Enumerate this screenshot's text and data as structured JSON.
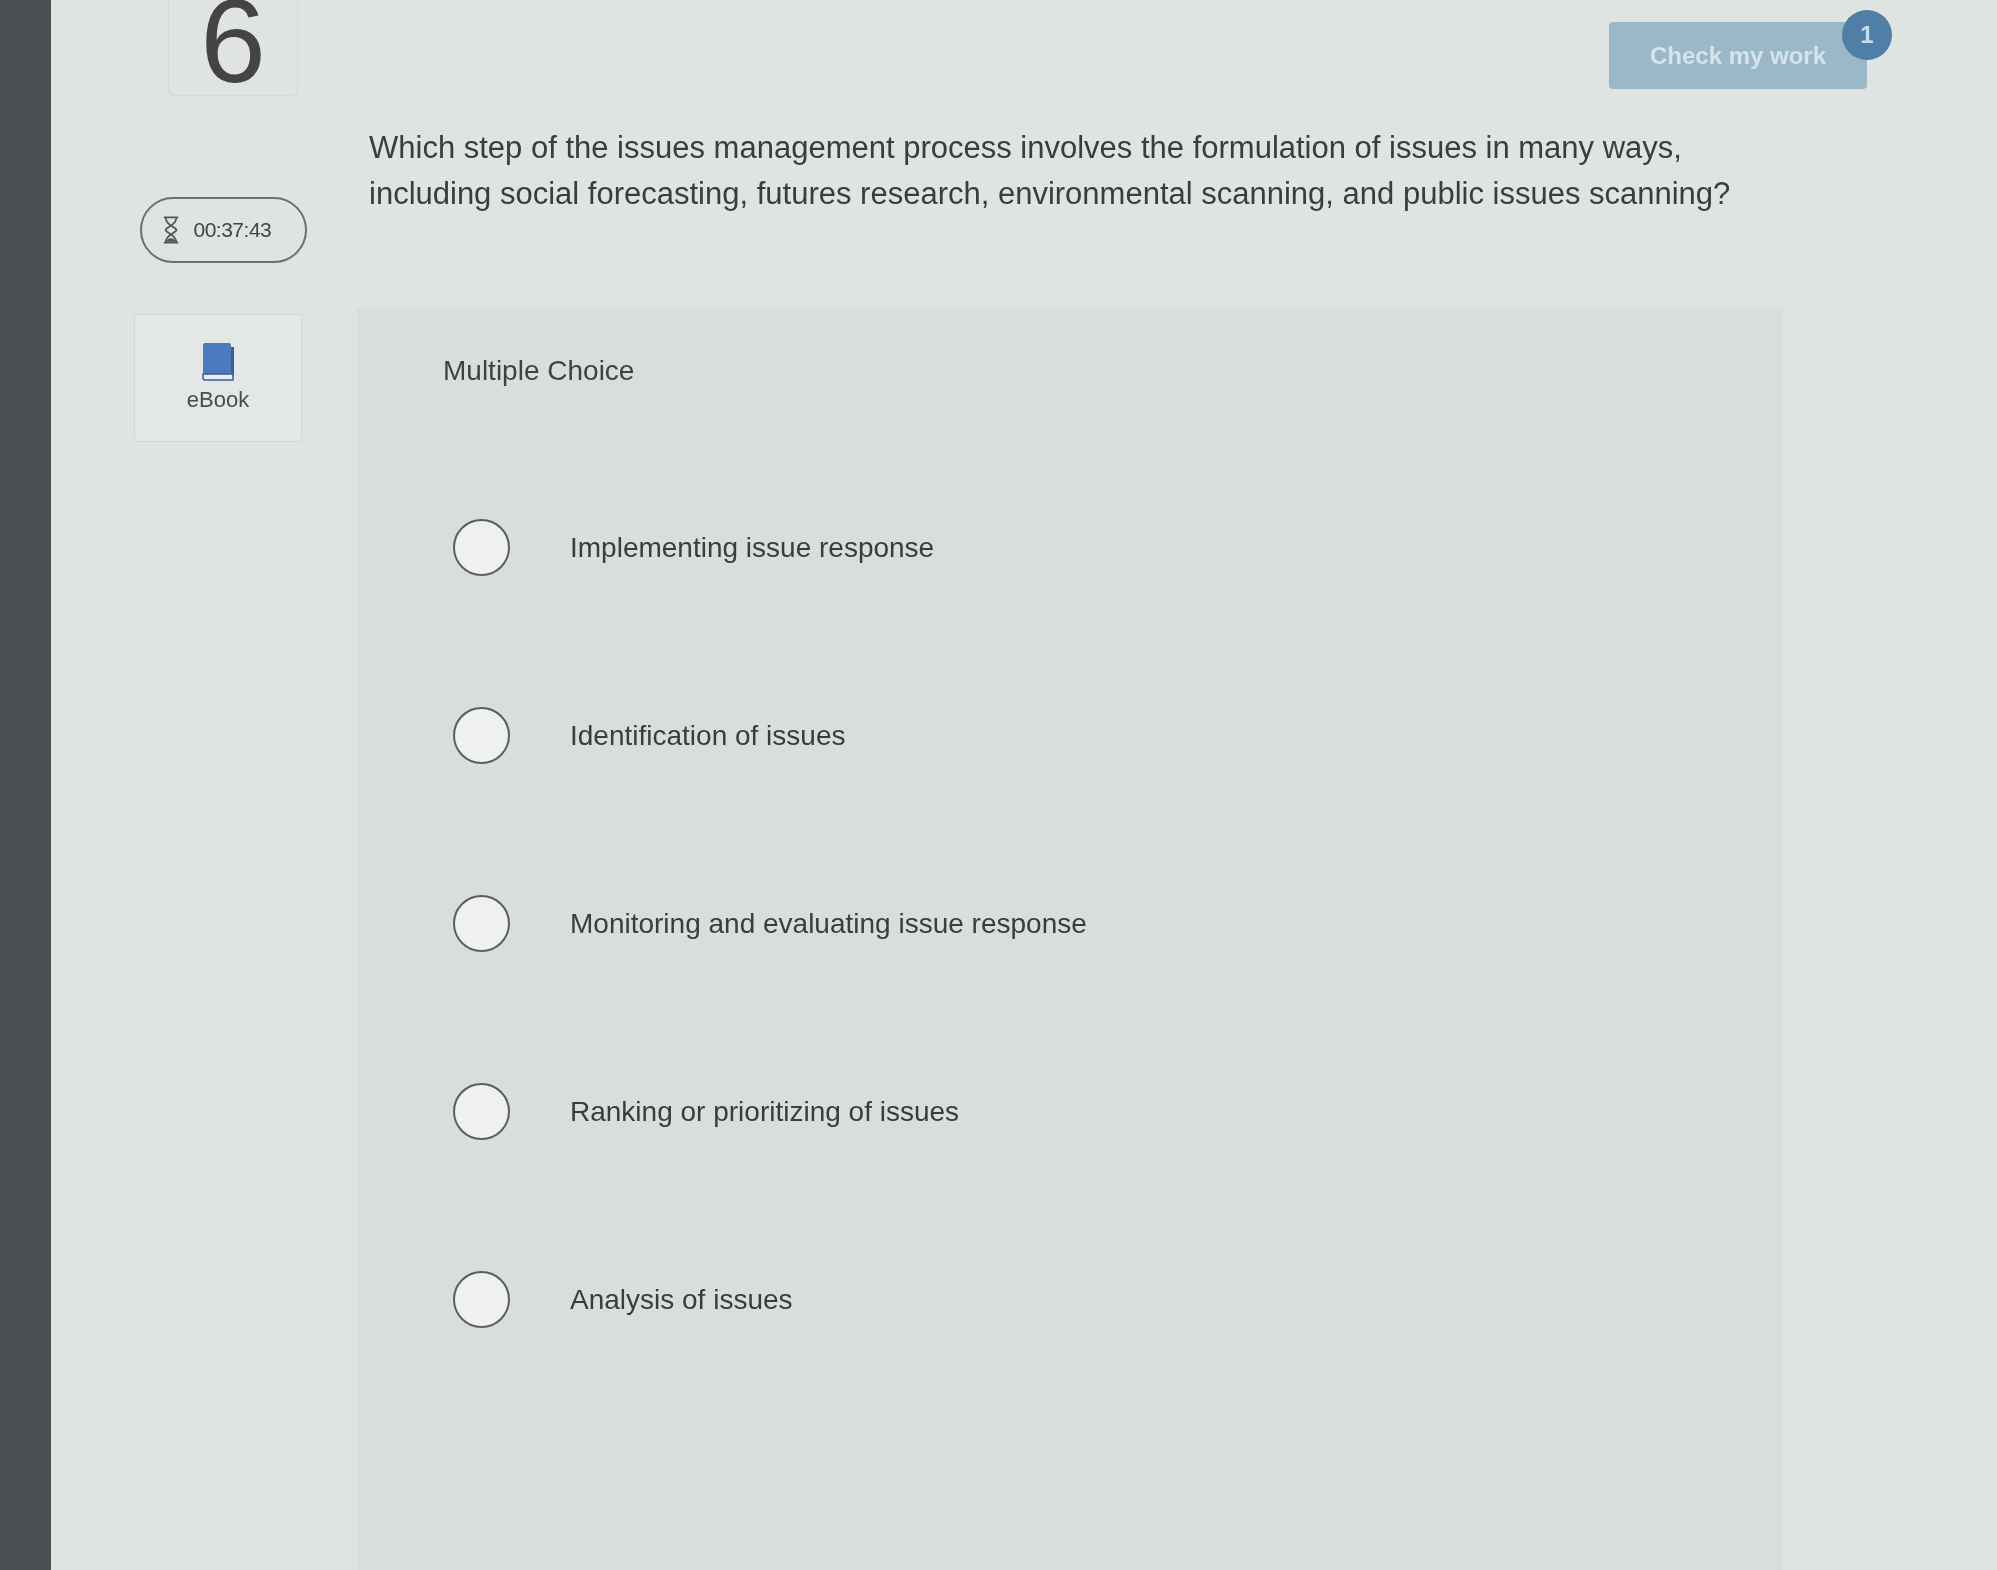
{
  "question_number": "6",
  "timer": {
    "time": "00:37:43"
  },
  "ebook": {
    "label": "eBook"
  },
  "check_button": {
    "label": "Check my work",
    "badge": "1",
    "disabled": true
  },
  "question": {
    "prompt": "Which step of the issues management process involves the formulation of issues in many ways, including social forecasting, futures research, environmental scanning, and public issues scanning?",
    "type_label": "Multiple Choice",
    "options": [
      {
        "label": "Implementing issue response",
        "selected": false
      },
      {
        "label": "Identification of issues",
        "selected": false
      },
      {
        "label": "Monitoring and evaluating issue response",
        "selected": false
      },
      {
        "label": "Ranking or prioritizing of issues",
        "selected": false
      },
      {
        "label": "Analysis of issues",
        "selected": false
      }
    ]
  }
}
